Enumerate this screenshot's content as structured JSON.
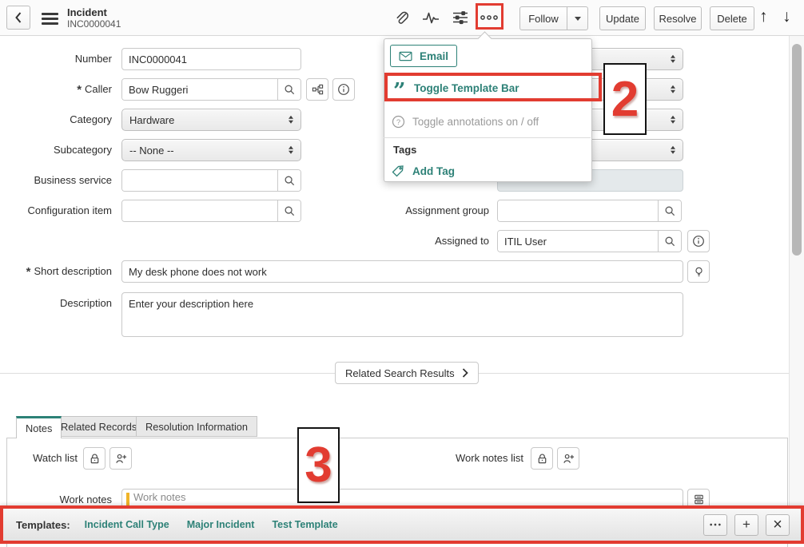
{
  "colors": {
    "accent": "#2d8177",
    "annotation_red": "#e23c31",
    "active_tab_border": "#2d8177",
    "work_notes_accent": "#f0b429"
  },
  "header": {
    "title": "Incident",
    "number": "INC0000041",
    "follow": "Follow",
    "update": "Update",
    "resolve": "Resolve",
    "delete": "Delete"
  },
  "menu": {
    "email": "Email",
    "toggle_template_bar": "Toggle Template Bar",
    "toggle_annotations": "Toggle annotations on / off",
    "tags_header": "Tags",
    "add_tag": "Add Tag"
  },
  "form": {
    "number": {
      "label": "Number",
      "value": "INC0000041"
    },
    "caller": {
      "label": "Caller",
      "value": "Bow Ruggeri",
      "required": "*"
    },
    "category": {
      "label": "Category",
      "value": "Hardware"
    },
    "subcategory": {
      "label": "Subcategory",
      "value": "-- None --"
    },
    "business_service": {
      "label": "Business service",
      "value": ""
    },
    "configuration_item": {
      "label": "Configuration item",
      "value": ""
    },
    "assignment_group": {
      "label": "Assignment group",
      "value": ""
    },
    "assigned_to": {
      "label": "Assigned to",
      "value": "ITIL User"
    },
    "short_description": {
      "label": "Short description",
      "value": "My desk phone does not work",
      "required": "*"
    },
    "description": {
      "label": "Description",
      "value": "Enter your description here"
    }
  },
  "related_search": {
    "label": "Related Search Results"
  },
  "tabs": {
    "notes": "Notes",
    "related_records": "Related Records",
    "resolution_information": "Resolution Information"
  },
  "notes_section": {
    "watch_list": "Watch list",
    "work_notes_list": "Work notes list",
    "work_notes": {
      "label": "Work notes",
      "placeholder": "Work notes"
    }
  },
  "template_bar": {
    "label": "Templates:",
    "templates": [
      "Incident Call Type",
      "Major Incident",
      "Test Template"
    ]
  },
  "annotations": {
    "step_2": "2",
    "step_3": "3"
  },
  "icons": {
    "quote": "”",
    "plus": "+",
    "close": "×",
    "arrow_up": "↑",
    "arrow_down": "↓"
  }
}
